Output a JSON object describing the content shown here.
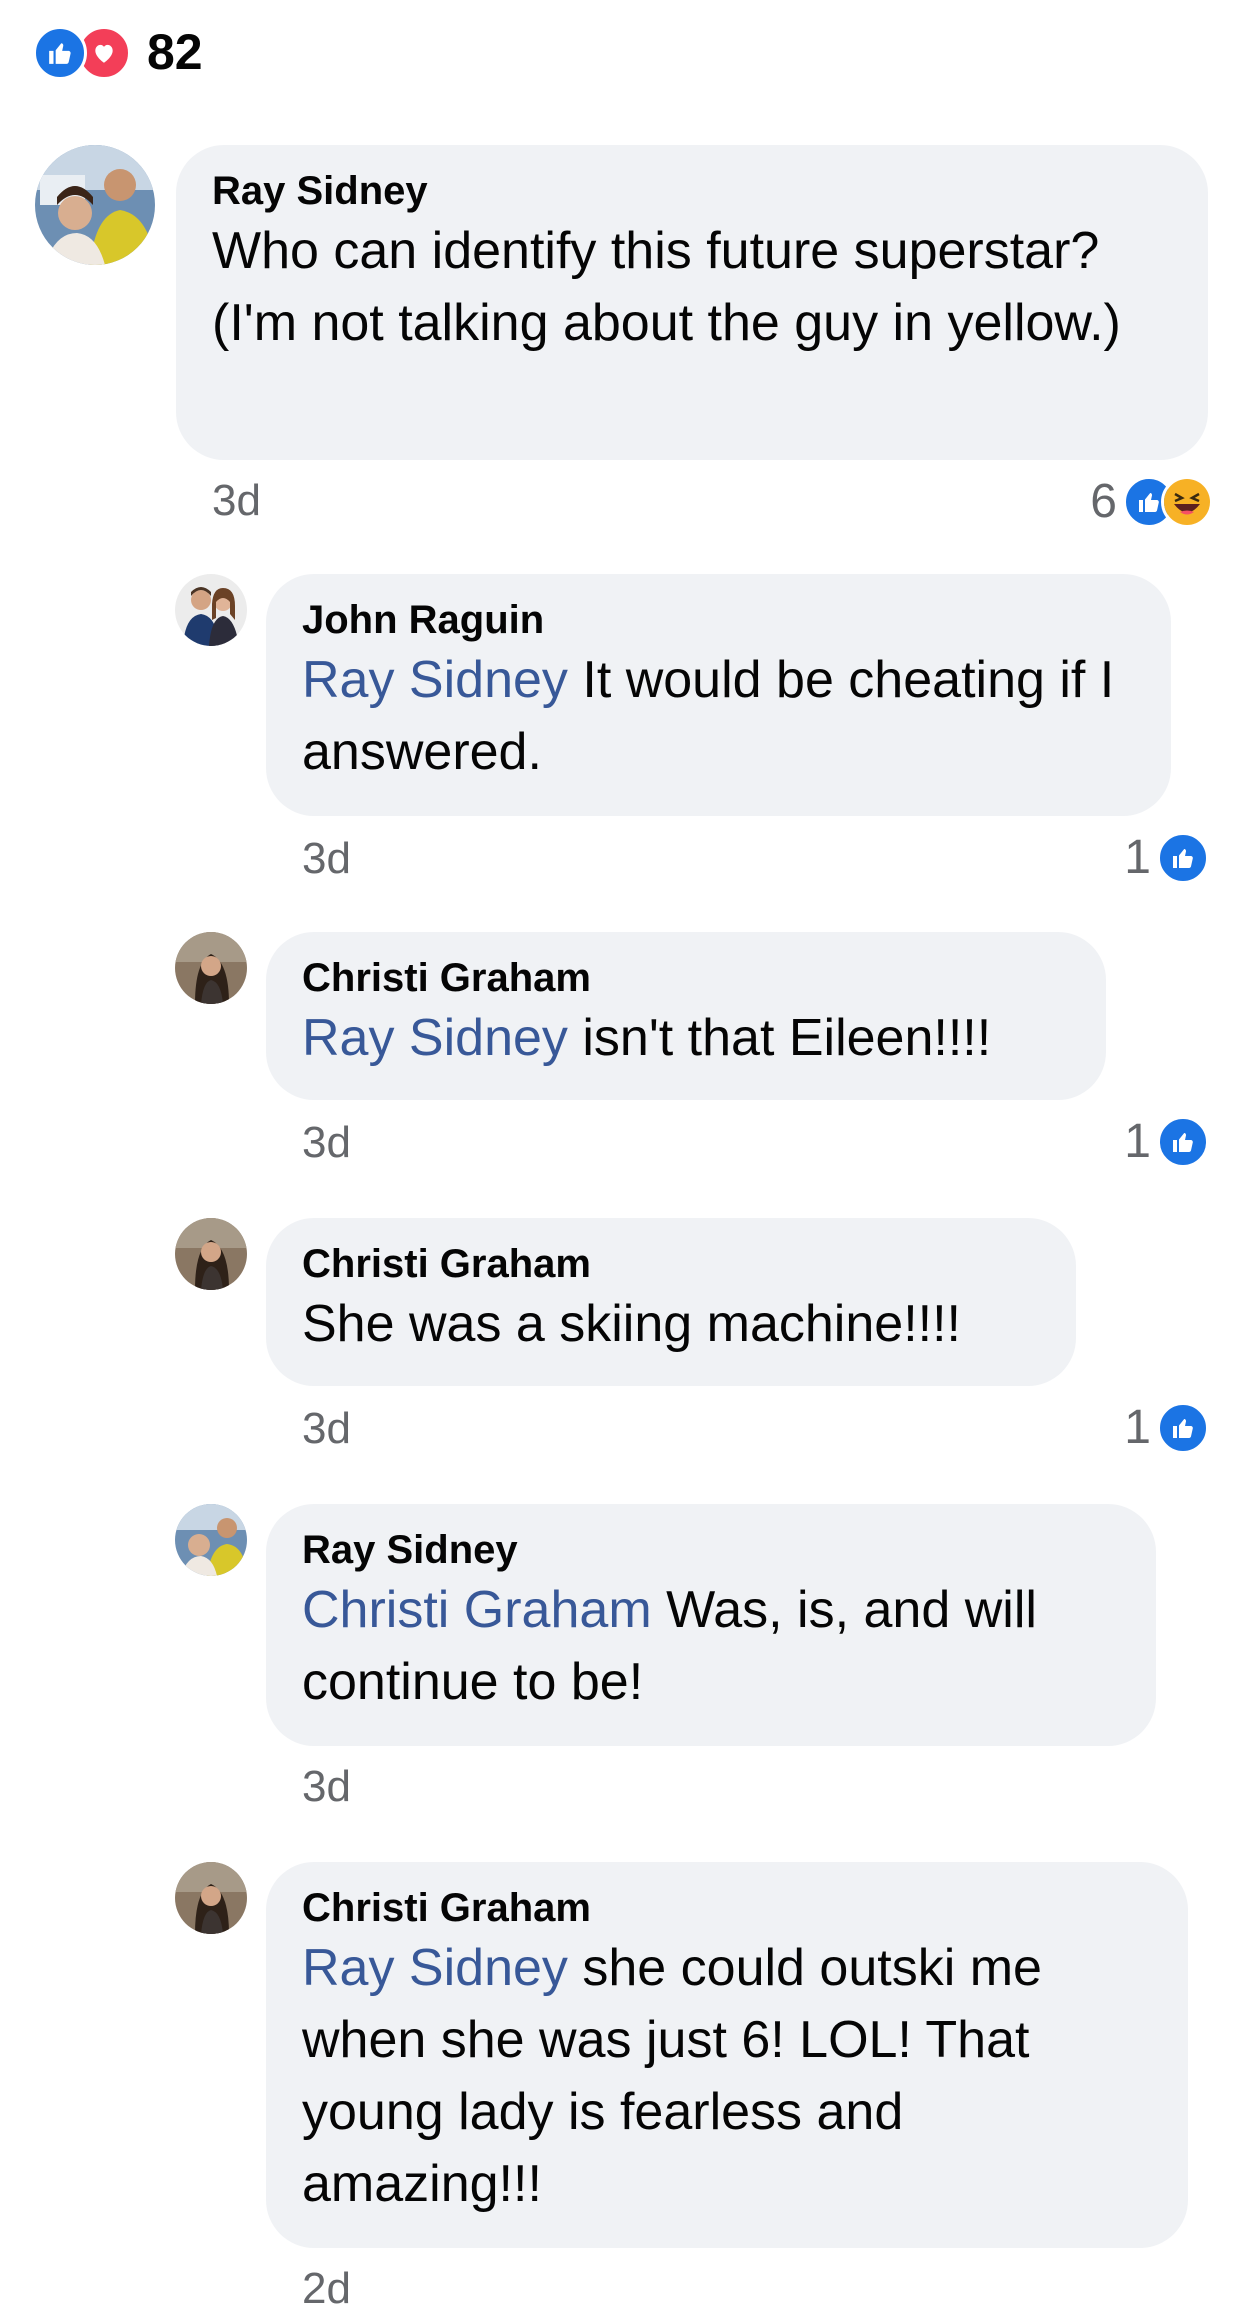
{
  "reactions": {
    "total": "82",
    "icons": [
      "like-icon",
      "love-icon"
    ]
  },
  "comments": [
    {
      "author": "Ray Sidney",
      "mention": "",
      "text": "Who can identify this future superstar? (I'm not talking about the guy in yellow.)",
      "time": "3d",
      "reaction_count": "6",
      "reaction_icons": [
        "like-icon",
        "haha-icon"
      ]
    },
    {
      "author": "John Raguin",
      "mention": "Ray Sidney",
      "text": " It would be cheating if I answered.",
      "time": "3d",
      "reaction_count": "1",
      "reaction_icons": [
        "like-icon"
      ]
    },
    {
      "author": "Christi Graham",
      "mention": "Ray Sidney",
      "text": " isn't that Eileen!!!!",
      "time": "3d",
      "reaction_count": "1",
      "reaction_icons": [
        "like-icon"
      ]
    },
    {
      "author": "Christi Graham",
      "mention": "",
      "text": "She was a skiing machine!!!!",
      "time": "3d",
      "reaction_count": "1",
      "reaction_icons": [
        "like-icon"
      ]
    },
    {
      "author": "Ray Sidney",
      "mention": "Christi Graham",
      "text": " Was, is, and will continue to be!",
      "time": "3d",
      "reaction_count": "",
      "reaction_icons": []
    },
    {
      "author": "Christi Graham",
      "mention": "Ray Sidney",
      "text": " she could outski me when she was just 6!  LOL!  That young lady is fearless and amazing!!!",
      "time": "2d",
      "reaction_count": "",
      "reaction_icons": []
    }
  ]
}
